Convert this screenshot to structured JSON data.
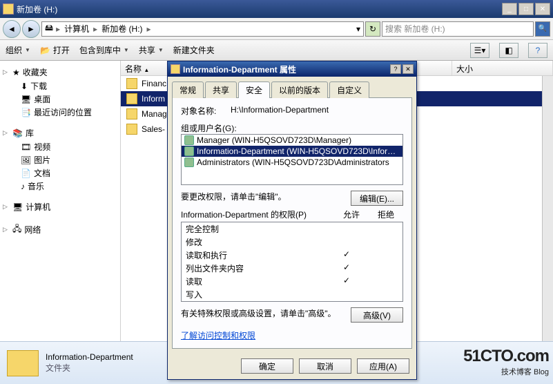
{
  "window": {
    "title": "新加卷 (H:)"
  },
  "nav": {
    "crumbs": [
      "计算机",
      "新加卷 (H:)"
    ],
    "search_placeholder": "搜索 新加卷 (H:)"
  },
  "toolbar": {
    "organize": "组织",
    "open": "打开",
    "include": "包含到库中",
    "share": "共享",
    "newfolder": "新建文件夹"
  },
  "sidebar": {
    "fav": {
      "label": "收藏夹",
      "items": [
        "下载",
        "桌面",
        "最近访问的位置"
      ]
    },
    "lib": {
      "label": "库",
      "items": [
        "视频",
        "图片",
        "文档",
        "音乐"
      ]
    },
    "computer": "计算机",
    "network": "网络"
  },
  "columns": {
    "name": "名称",
    "date": "",
    "type": "",
    "size": "大小"
  },
  "files": {
    "items": [
      {
        "name": "Financ"
      },
      {
        "name": "Inform"
      },
      {
        "name": "Manage"
      },
      {
        "name": "Sales-"
      }
    ],
    "selected_index": 1
  },
  "status": {
    "name": "Information-Department",
    "type": "文件夹"
  },
  "dialog": {
    "title": "Information-Department 属性",
    "tabs": [
      "常规",
      "共享",
      "安全",
      "以前的版本",
      "自定义"
    ],
    "active_tab": 2,
    "object_label": "对象名称:",
    "object_value": "H:\\Information-Department",
    "groups_label": "组或用户名(G):",
    "groups": [
      "Manager (WIN-H5QSOVD723D\\Manager)",
      "Information-Department (WIN-H5QSOVD723D\\Infor…",
      "Administrators (WIN-H5QSOVD723D\\Administrators"
    ],
    "selected_group": 1,
    "edit_hint": "要更改权限，请单击\"编辑\"。",
    "edit_btn": "编辑(E)...",
    "perm_for_label": "Information-Department 的权限(P)",
    "col_allow": "允许",
    "col_deny": "拒绝",
    "perms": [
      {
        "name": "完全控制",
        "allow": false,
        "deny": false
      },
      {
        "name": "修改",
        "allow": false,
        "deny": false
      },
      {
        "name": "读取和执行",
        "allow": true,
        "deny": false
      },
      {
        "name": "列出文件夹内容",
        "allow": true,
        "deny": false
      },
      {
        "name": "读取",
        "allow": true,
        "deny": false
      },
      {
        "name": "写入",
        "allow": false,
        "deny": false
      }
    ],
    "adv_hint": "有关特殊权限或高级设置，请单击\"高级\"。",
    "adv_btn": "高级(V)",
    "link": "了解访问控制和权限",
    "ok": "确定",
    "cancel": "取消",
    "apply": "应用(A)"
  },
  "watermark": {
    "big": "51CTO.com",
    "sm": "技术博客      Blog"
  }
}
